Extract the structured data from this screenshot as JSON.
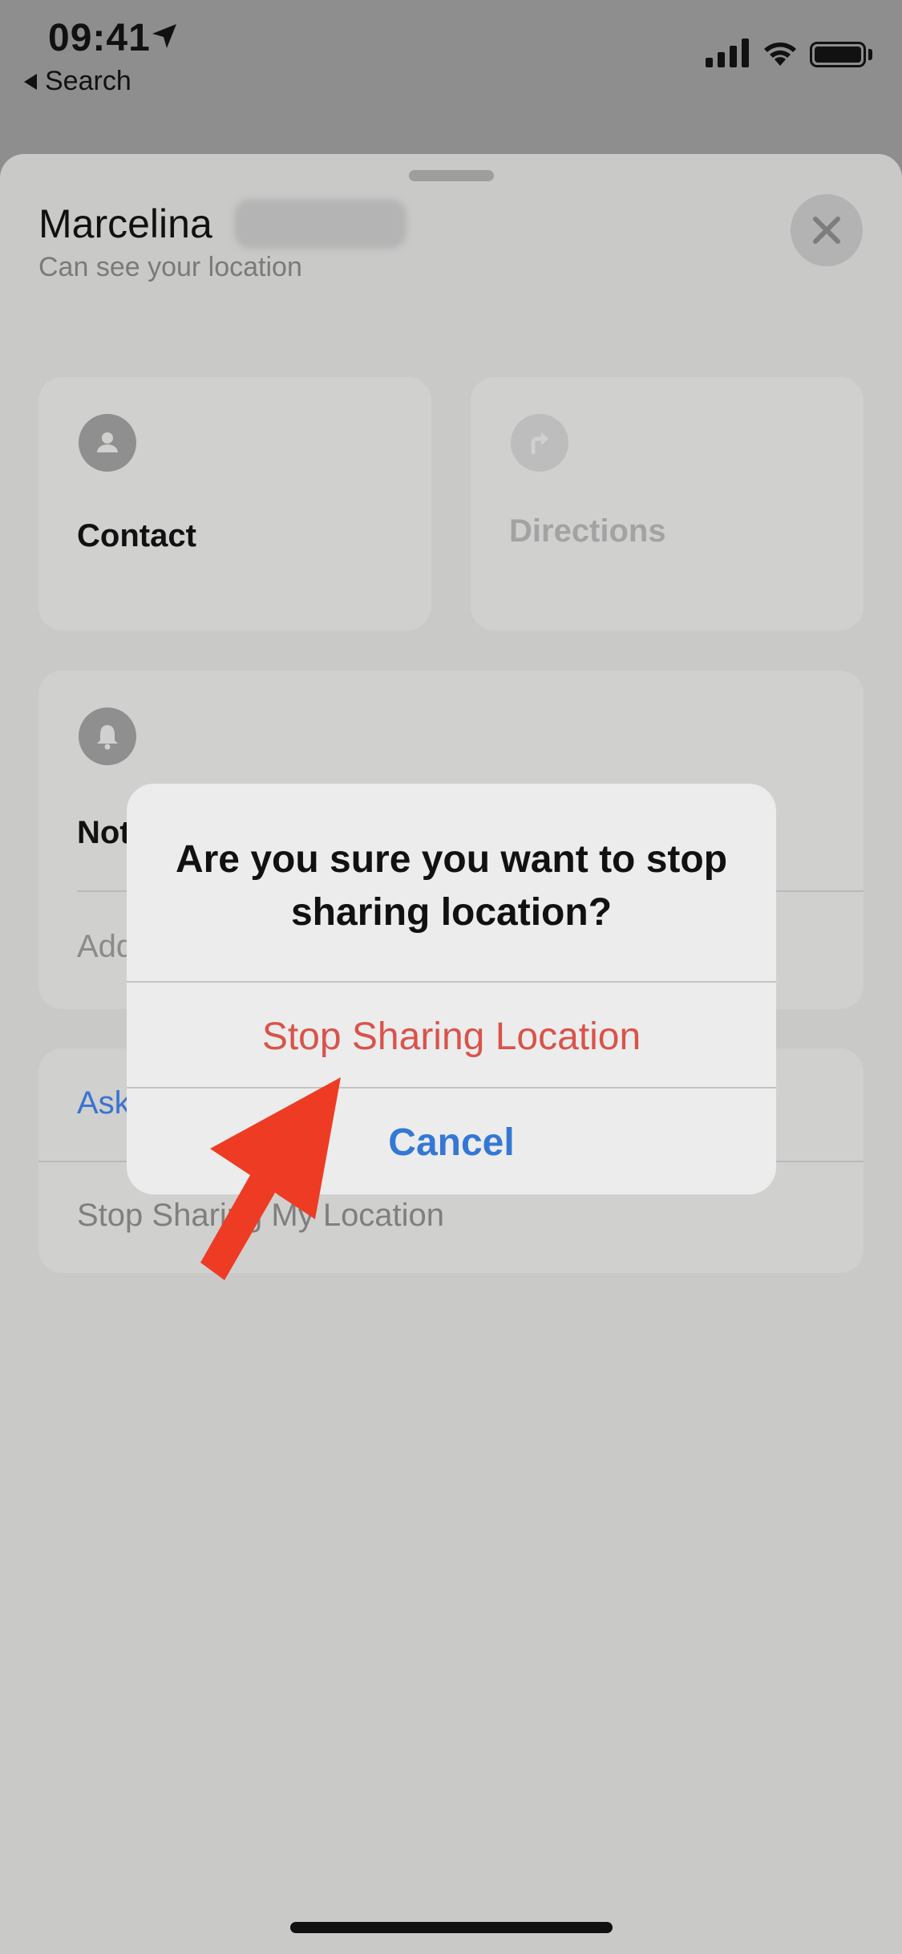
{
  "status_bar": {
    "time": "09:41",
    "back_label": "Search"
  },
  "sheet": {
    "contact_name": "Marcelina",
    "subtitle": "Can see your location",
    "contact_card": {
      "label": "Contact"
    },
    "directions_card": {
      "label": "Directions"
    },
    "notifications_card": {
      "label_visible": "Not",
      "row_visible": "Add"
    },
    "ask_card": {
      "row1_visible": "Ask",
      "row2": "Stop Sharing My Location"
    }
  },
  "dialog": {
    "title": "Are you sure you want to stop sharing location?",
    "primary_action": "Stop Sharing Location",
    "cancel_action": "Cancel"
  },
  "colors": {
    "destructive": "#d9534a",
    "accent": "#3478d6",
    "annotation_arrow": "#ee3b24"
  }
}
